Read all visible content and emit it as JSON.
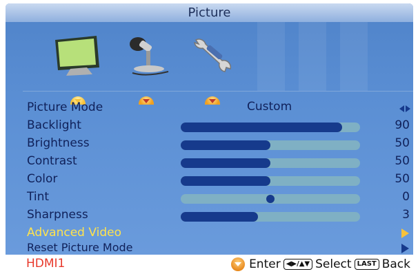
{
  "osd": {
    "title": "Picture",
    "tabs": [
      {
        "name": "picture",
        "icon": "tv-monitor-icon",
        "active": true
      },
      {
        "name": "audio",
        "icon": "microphone-icon",
        "active": false
      },
      {
        "name": "setup",
        "icon": "wrench-icon",
        "active": false
      }
    ]
  },
  "menu": {
    "picture_mode": {
      "label": "Picture Mode",
      "value": "Custom"
    },
    "backlight": {
      "label": "Backlight",
      "value": "90",
      "level": 0.9
    },
    "brightness": {
      "label": "Brightness",
      "value": "50",
      "level": 0.5
    },
    "contrast": {
      "label": "Contrast",
      "value": "50",
      "level": 0.5
    },
    "color": {
      "label": "Color",
      "value": "50",
      "level": 0.5
    },
    "tint": {
      "label": "Tint",
      "value": "0",
      "level": 0.5
    },
    "sharpness": {
      "label": "Sharpness",
      "value": "3",
      "level": 0.43
    },
    "advanced_video": {
      "label": "Advanced Video"
    },
    "reset_picture_mode": {
      "label": "Reset Picture Mode"
    }
  },
  "footer": {
    "input_source": "HDMI1",
    "enter_label": "Enter",
    "nav_keys": "◀▶/▲▼",
    "select_label": "Select",
    "last_key": "LAST",
    "back_label": "Back"
  },
  "colors": {
    "accent": "#f7c23a",
    "bar_fill": "#163a8c",
    "bar_track": "#7fb0c4",
    "source_text": "#e8382a"
  }
}
